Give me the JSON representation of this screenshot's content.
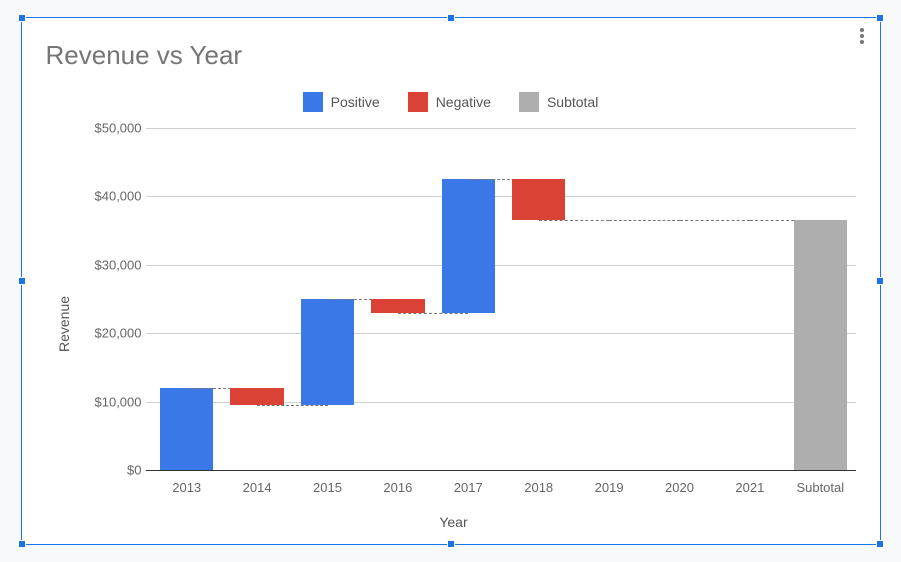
{
  "chart": {
    "title": "Revenue  vs Year",
    "xlabel": "Year",
    "ylabel": "Revenue"
  },
  "legend": {
    "positive": "Positive",
    "negative": "Negative",
    "subtotal": "Subtotal"
  },
  "yaxis": {
    "ticks": [
      "$0",
      "$10,000",
      "$20,000",
      "$30,000",
      "$40,000",
      "$50,000"
    ],
    "min": 0,
    "max": 50000
  },
  "categories": [
    "2013",
    "2014",
    "2015",
    "2016",
    "2017",
    "2018",
    "2019",
    "2020",
    "2021",
    "Subtotal"
  ],
  "chart_data": {
    "type": "bar",
    "subtype": "waterfall",
    "title": "Revenue  vs Year",
    "xlabel": "Year",
    "ylabel": "Revenue",
    "ylim": [
      0,
      50000
    ],
    "categories": [
      "2013",
      "2014",
      "2015",
      "2016",
      "2017",
      "2018",
      "2019",
      "2020",
      "2021",
      "Subtotal"
    ],
    "bars": [
      {
        "label": "2013",
        "kind": "positive",
        "start": 0,
        "end": 12000,
        "delta": 12000
      },
      {
        "label": "2014",
        "kind": "negative",
        "start": 12000,
        "end": 9500,
        "delta": -2500
      },
      {
        "label": "2015",
        "kind": "positive",
        "start": 9500,
        "end": 25000,
        "delta": 15500
      },
      {
        "label": "2016",
        "kind": "negative",
        "start": 25000,
        "end": 23000,
        "delta": -2000
      },
      {
        "label": "2017",
        "kind": "positive",
        "start": 23000,
        "end": 42500,
        "delta": 19500
      },
      {
        "label": "2018",
        "kind": "negative",
        "start": 42500,
        "end": 36500,
        "delta": -6000
      },
      {
        "label": "2019",
        "kind": "positive",
        "start": 36500,
        "end": 36500,
        "delta": 0
      },
      {
        "label": "2020",
        "kind": "positive",
        "start": 36500,
        "end": 36500,
        "delta": 0
      },
      {
        "label": "2021",
        "kind": "positive",
        "start": 36500,
        "end": 36500,
        "delta": 0
      },
      {
        "label": "Subtotal",
        "kind": "subtotal",
        "start": 0,
        "end": 36500,
        "delta": 36500
      }
    ]
  },
  "colors": {
    "positive": "#3b78e7",
    "negative": "#d94235",
    "subtotal": "#aeaeae"
  }
}
